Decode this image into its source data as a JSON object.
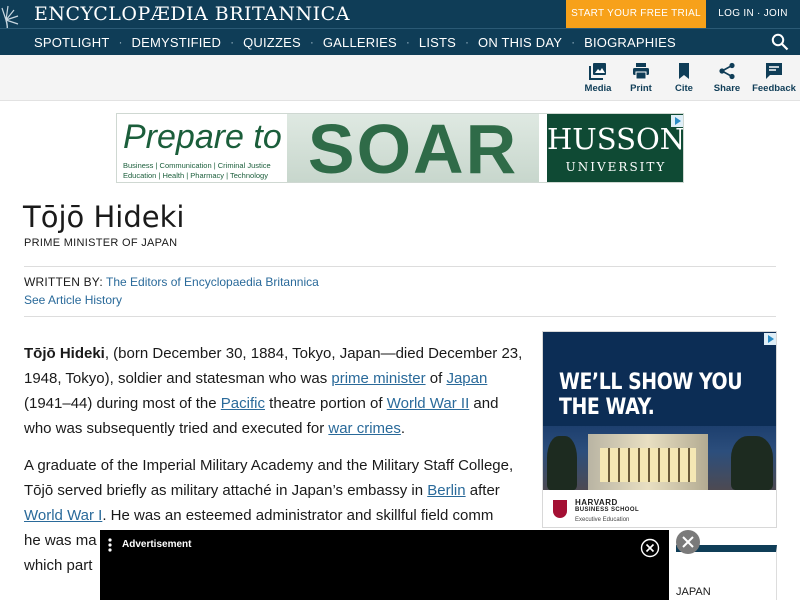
{
  "header": {
    "brand": "ENCYCLOPÆDIA BRITANNICA",
    "trial_button": "START YOUR FREE TRIAL",
    "login": "LOG IN · JOIN",
    "nav": [
      "SPOTLIGHT",
      "DEMYSTIFIED",
      "QUIZZES",
      "GALLERIES",
      "LISTS",
      "ON THIS DAY",
      "BIOGRAPHIES"
    ],
    "nav_separator": "·"
  },
  "toolbar": {
    "media": "Media",
    "print": "Print",
    "cite": "Cite",
    "share": "Share",
    "feedback": "Feedback"
  },
  "ad_top": {
    "headline": "Prepare to",
    "word": "SOAR",
    "programs_line1": "Business | Communication | Criminal Justice",
    "programs_line2": "Education | Health | Pharmacy | Technology",
    "brand": "HUSSON",
    "brand_sub": "UNIVERSITY"
  },
  "article": {
    "title": "Tōjō Hideki",
    "subtitle": "PRIME MINISTER OF JAPAN",
    "written_by_label": "WRITTEN BY:",
    "author": "The Editors of Encyclopaedia Britannica",
    "history_link": "See Article History",
    "p1": {
      "name": "Tōjō Hideki",
      "t1": ", (born December 30, 1884, Tokyo, Japan—died December 23, 1948, Tokyo), soldier and statesman who was ",
      "l1": "prime minister",
      "t2": " of ",
      "l2": "Japan",
      "t3": " (1941–44) during most of the ",
      "l3": "Pacific",
      "t4": " theatre portion of ",
      "l4": "World War II",
      "t5": " and who was subsequently tried and executed for ",
      "l5": "war crimes",
      "t6": "."
    },
    "p2": {
      "t1": "A graduate of the Imperial Military Academy and the Military Staff College, Tōjō served briefly as military attaché in Japan’s embassy in ",
      "l1": "Berlin",
      "t2": " after ",
      "l2": "World War I",
      "t3": ". He was an esteemed administrator and skillful field comm",
      "t4": "he was ma",
      "t5": "which part"
    }
  },
  "ad_side": {
    "headline_line1": "WE’LL SHOW YOU",
    "headline_line2": "THE WAY.",
    "school_line1": "HARVARD",
    "school_line2": "BUSINESS SCHOOL",
    "school_line3": "Executive Education"
  },
  "side_card": {
    "text": "JAPAN"
  },
  "ad_bottom": {
    "label": "Advertisement"
  },
  "colors": {
    "header_bg": "#0f3d57",
    "trial_bg": "#f7a11a",
    "link": "#2a6a9a"
  }
}
